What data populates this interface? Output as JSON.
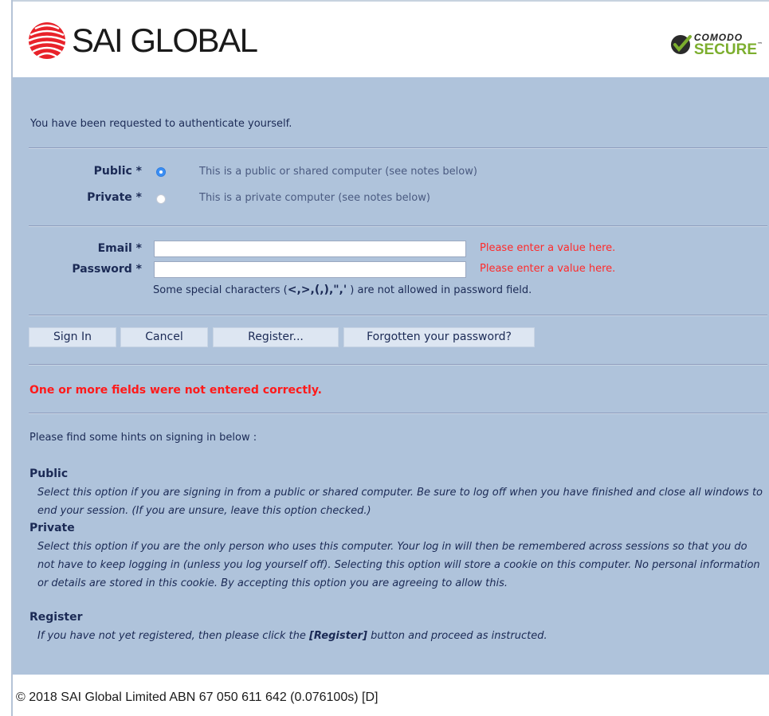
{
  "header": {
    "logo_text": "SAI GLOBAL",
    "badge_top": "COMODO",
    "badge_bottom": "SECURE",
    "badge_tm": "™"
  },
  "intro": "You have been requested to authenticate yourself.",
  "computer_type": {
    "public_label": "Public *",
    "public_note": "This is a public or shared computer (see notes below)",
    "private_label": "Private *",
    "private_note": "This is a private computer (see notes below)",
    "selected": "public"
  },
  "form": {
    "email_label": "Email *",
    "email_value": "",
    "email_error": "Please enter a value here.",
    "password_label": "Password *",
    "password_value": "",
    "password_error": "Please enter a value here.",
    "special_prefix": "Some special characters (",
    "special_chars": "<,>,(,),\",'",
    "special_suffix": " ) are not allowed in password field."
  },
  "buttons": {
    "sign_in": "Sign In",
    "cancel": "Cancel",
    "register": "Register...",
    "forgot": "Forgotten your password?"
  },
  "error_message": "One or more fields were not entered correctly.",
  "hints": {
    "intro": "Please find some hints on signing in below :",
    "public_title": "Public",
    "public_text": "Select this option if you are signing in from a public or shared computer. Be sure to log off when you have finished and close all windows to end your session. (If you are unsure, leave this option checked.)",
    "private_title": "Private",
    "private_text": "Select this option if you are the only person who uses this computer. Your log in will then be remembered across sessions so that you do not have to keep logging in (unless you log yourself off). Selecting this option will store a cookie on this computer. No personal information or details are stored in this cookie. By accepting this option you are agreeing to allow this.",
    "register_title": "Register",
    "register_prefix": "If you have not yet registered, then please click the ",
    "register_link": "[Register]",
    "register_suffix": " button and proceed as instructed."
  },
  "footer": "© 2018 SAI Global Limited ABN 67 050 611 642 (0.076100s) [D]",
  "colors": {
    "panel": "#afc3db",
    "error": "#ff2a2a",
    "radio_selected": "#3b8ff5",
    "logo_red": "#e8222a",
    "badge_green": "#7cae2e"
  }
}
